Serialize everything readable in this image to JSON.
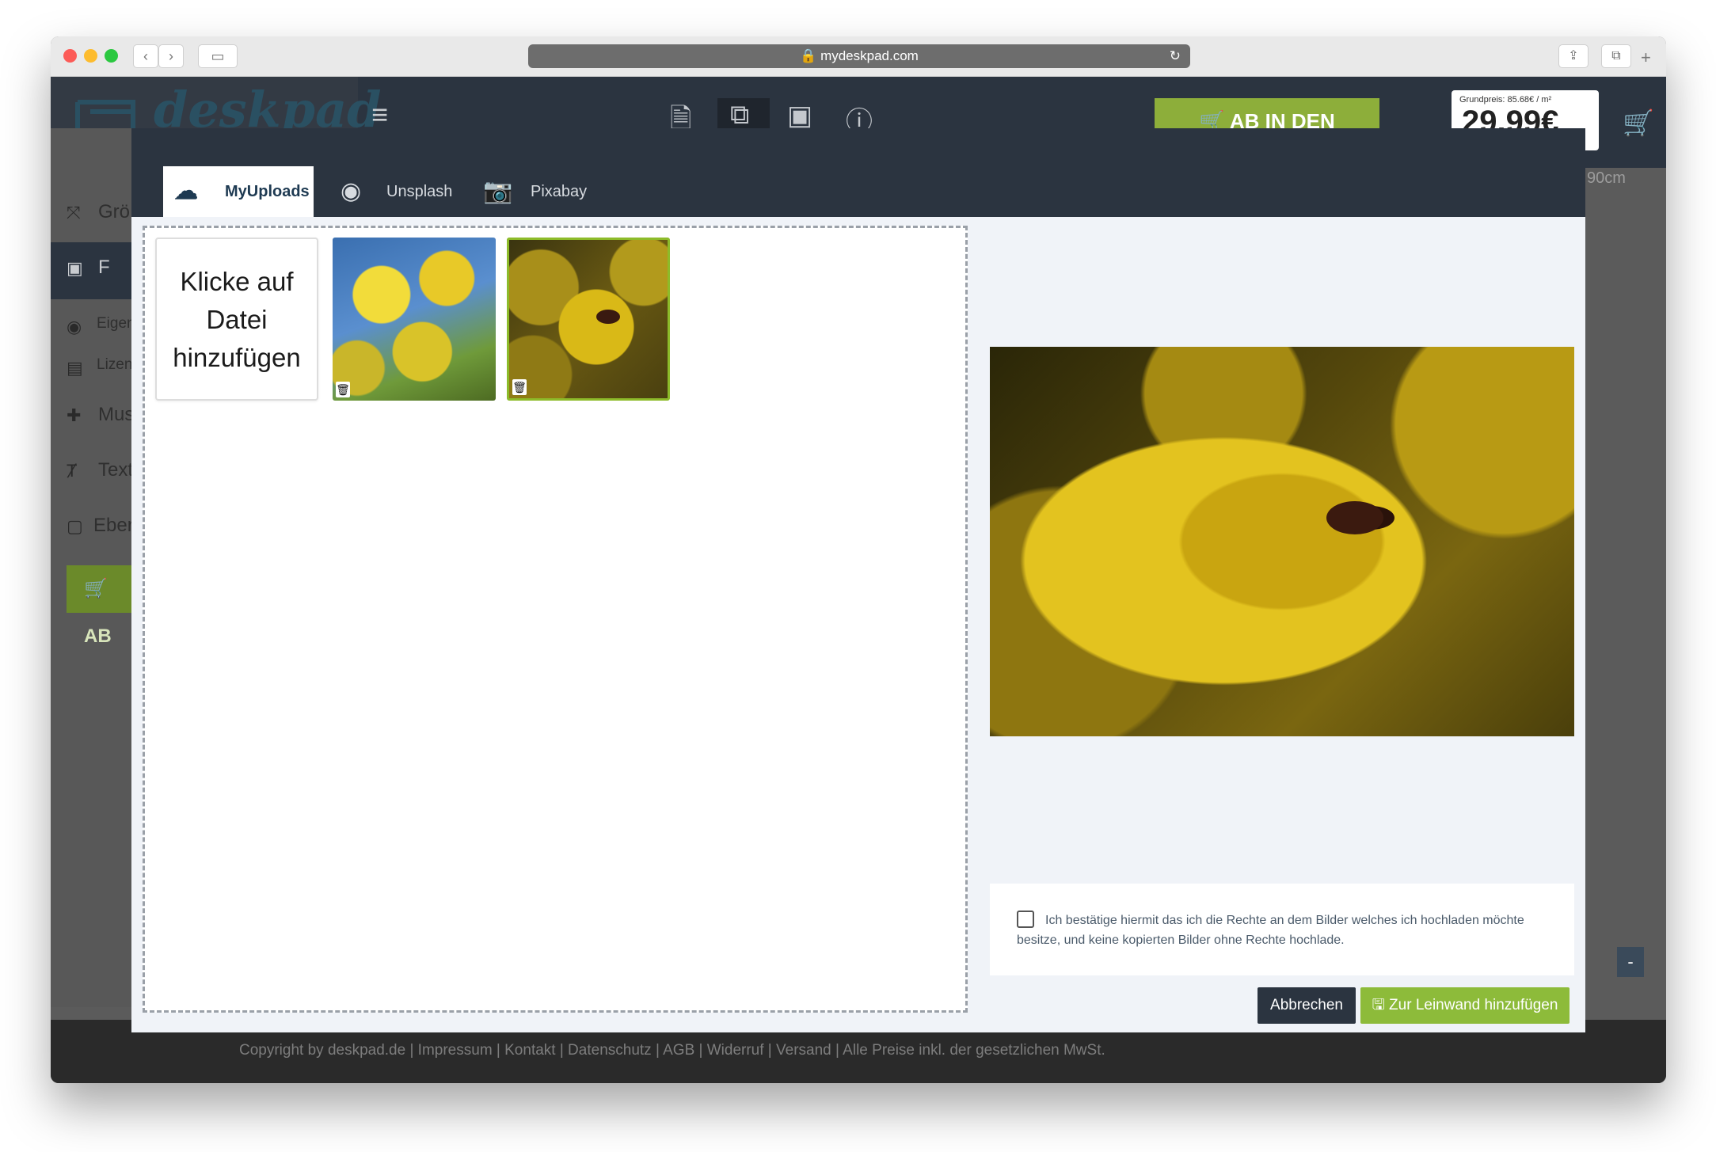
{
  "browser": {
    "url": "mydeskpad.com",
    "back_glyph": "‹",
    "forward_glyph": "›",
    "plus_glyph": "+"
  },
  "site": {
    "logo_text": "deskpad",
    "cart_button_label": "AB IN DEN WARENKORB",
    "price_small": "Grundpreis: 85.68€ / m²",
    "price_big": "29.99€",
    "ruler_label": "90cm",
    "minus_label": "-"
  },
  "sidebar": {
    "items": [
      {
        "icon": "resize-icon",
        "label": "Grö"
      },
      {
        "icon": "image-icon",
        "label": "F"
      },
      {
        "icon": "camera-icon",
        "label": "Eigen"
      },
      {
        "icon": "license-icon",
        "label": "Lizen"
      },
      {
        "icon": "puzzle-icon",
        "label": "Mus"
      },
      {
        "icon": "text-icon",
        "label": "Text"
      },
      {
        "icon": "layer-icon",
        "label": "Eber"
      }
    ],
    "green_button_label": "AB"
  },
  "modal": {
    "tabs": [
      {
        "label": "MyUploads",
        "icon": "cloud-upload-icon",
        "active": true
      },
      {
        "label": "Unsplash",
        "icon": "camera-icon",
        "active": false
      },
      {
        "label": "Pixabay",
        "icon": "photo-camera-icon",
        "active": false
      }
    ],
    "add_file_text": "Klicke auf Datei hinzufügen",
    "consent_text": "Ich bestätige hiermit das ich die Rechte an dem Bilder welches ich hochladen möchte besitze, und keine kopierten Bilder ohne Rechte hochlade.",
    "cancel_label": "Abbrechen",
    "add_label": "Zur Leinwand hinzufügen"
  },
  "footer": {
    "text": "Copyright by deskpad.de | Impressum | Kontakt | Datenschutz | AGB | Widerruf | Versand | Alle Preise inkl. der gesetzlichen MwSt."
  },
  "colors": {
    "header_dark": "#2b3440",
    "accent_green": "#8dbb3a",
    "selected_border": "#8dbb2a"
  }
}
